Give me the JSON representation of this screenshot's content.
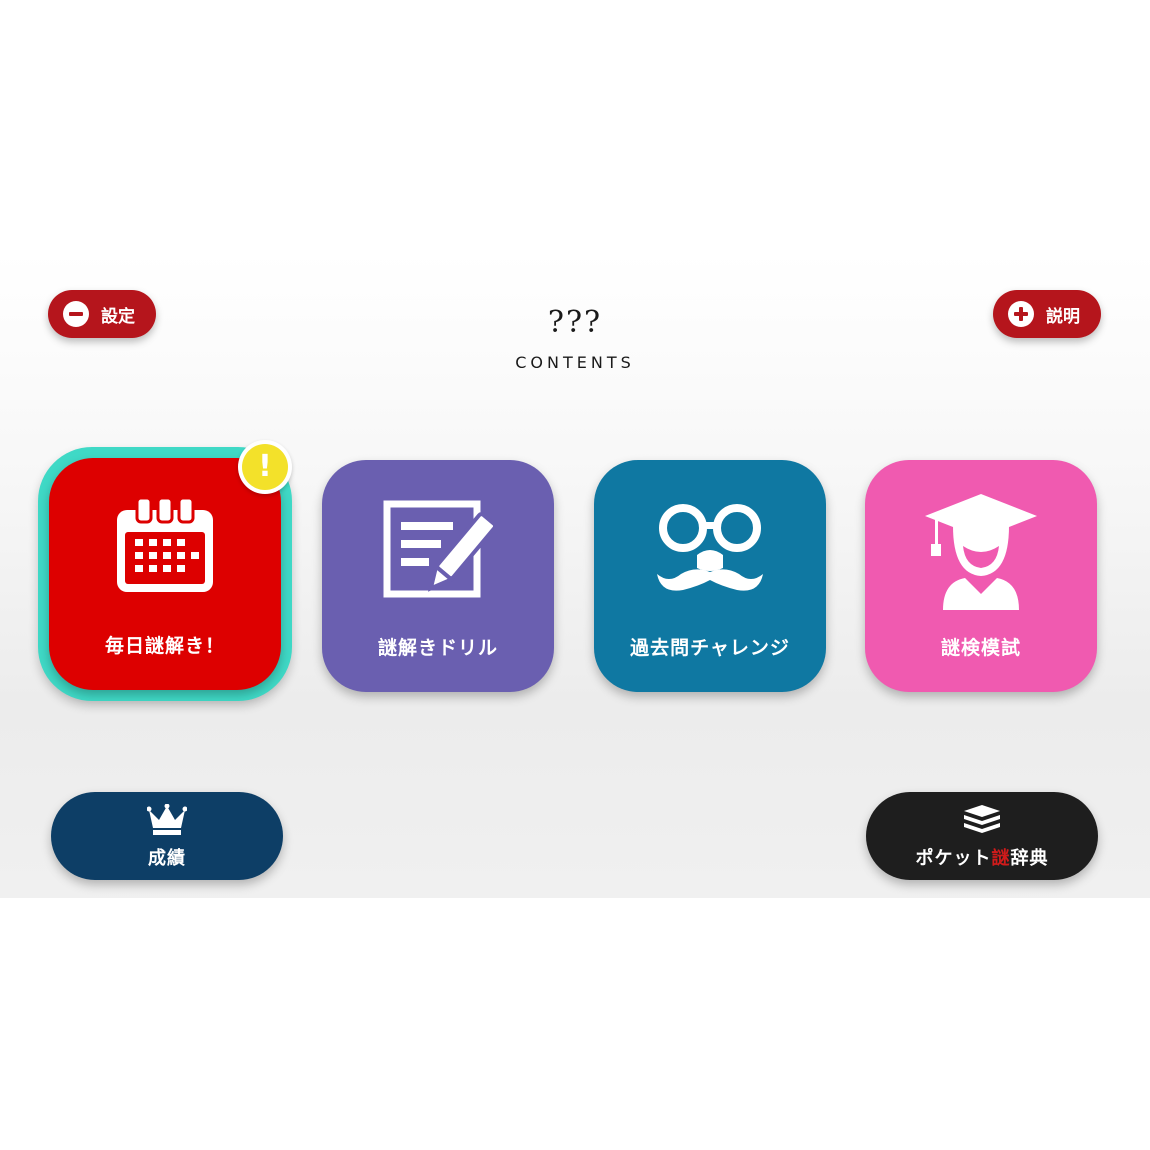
{
  "header": {
    "settings_label": "設定",
    "help_label": "説明",
    "logo_marks": "???",
    "logo_text": "CONTENTS"
  },
  "tiles": [
    {
      "label": "毎日謎解き！",
      "color": "#dd0000",
      "icon": "calendar-icon",
      "selected": true,
      "badge": "!"
    },
    {
      "label": "謎解きドリル",
      "color": "#6a5fb0",
      "icon": "notebook-pen-icon",
      "selected": false
    },
    {
      "label": "過去問チャレンジ",
      "color": "#0f78a2",
      "icon": "glasses-mustache-icon",
      "selected": false
    },
    {
      "label": "謎検模試",
      "color": "#f05ab0",
      "icon": "graduate-icon",
      "selected": false
    }
  ],
  "bottom": {
    "records_label": "成績",
    "dictionary_label_pre": "ポケット",
    "dictionary_label_red": "謎",
    "dictionary_label_post": "辞典"
  },
  "colors": {
    "accent_red": "#b5151c",
    "selection": "#3fd9c6",
    "records_bg": "#0d3e66",
    "dictionary_bg": "#1e1e1e"
  }
}
